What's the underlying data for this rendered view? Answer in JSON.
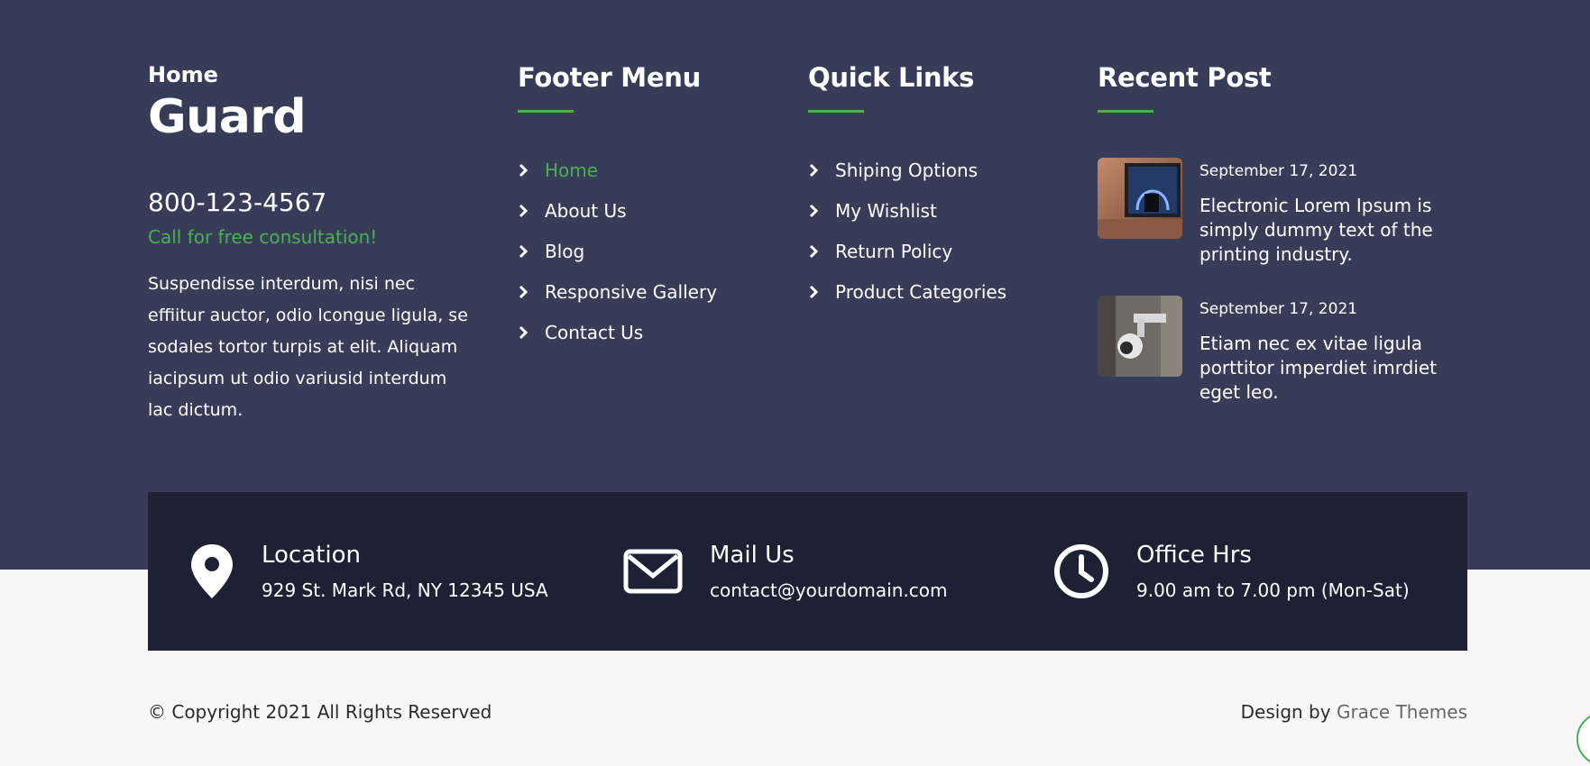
{
  "brand": {
    "small": "Home",
    "big": "Guard",
    "phone": "800-123-4567",
    "phone_sub": "Call for free consultation!",
    "about": "Suspendisse interdum, nisi nec effiitur auctor, odio lcongue ligula, se sodales tortor turpis at elit. Aliquam iacipsum ut odio variusid interdum lac dictum."
  },
  "footer_menu": {
    "heading": "Footer Menu",
    "items": [
      {
        "label": "Home",
        "active": true
      },
      {
        "label": "About Us"
      },
      {
        "label": "Blog"
      },
      {
        "label": "Responsive Gallery"
      },
      {
        "label": "Contact Us"
      }
    ]
  },
  "quick_links": {
    "heading": "Quick Links",
    "items": [
      {
        "label": "Shiping Options"
      },
      {
        "label": "My Wishlist"
      },
      {
        "label": "Return Policy"
      },
      {
        "label": "Product Categories"
      }
    ]
  },
  "recent_post": {
    "heading": "Recent Post",
    "posts": [
      {
        "date": "September 17, 2021",
        "title": "Electronic Lorem Ipsum is simply dummy text of the printing industry."
      },
      {
        "date": "September 17, 2021",
        "title": "Etiam nec ex vitae ligula porttitor imperdiet imrdiet eget leo."
      }
    ]
  },
  "contact": {
    "location": {
      "title": "Location",
      "value": "929 St. Mark Rd, NY 12345 USA",
      "icon": "map-pin-icon"
    },
    "mail": {
      "title": "Mail Us",
      "value": "contact@yourdomain.com",
      "icon": "envelope-icon"
    },
    "hours": {
      "title": "Office Hrs",
      "value": "9.00 am to 7.00 pm (Mon-Sat)",
      "icon": "clock-icon"
    }
  },
  "bottom": {
    "copyright": "© Copyright 2021 All Rights Reserved",
    "design_prefix": "Design by ",
    "design_link": "Grace Themes"
  },
  "colors": {
    "footer_bg": "#373d58",
    "strip_bg": "#1d2133",
    "accent": "#4caf50",
    "page_bg": "#f7f7f7"
  }
}
